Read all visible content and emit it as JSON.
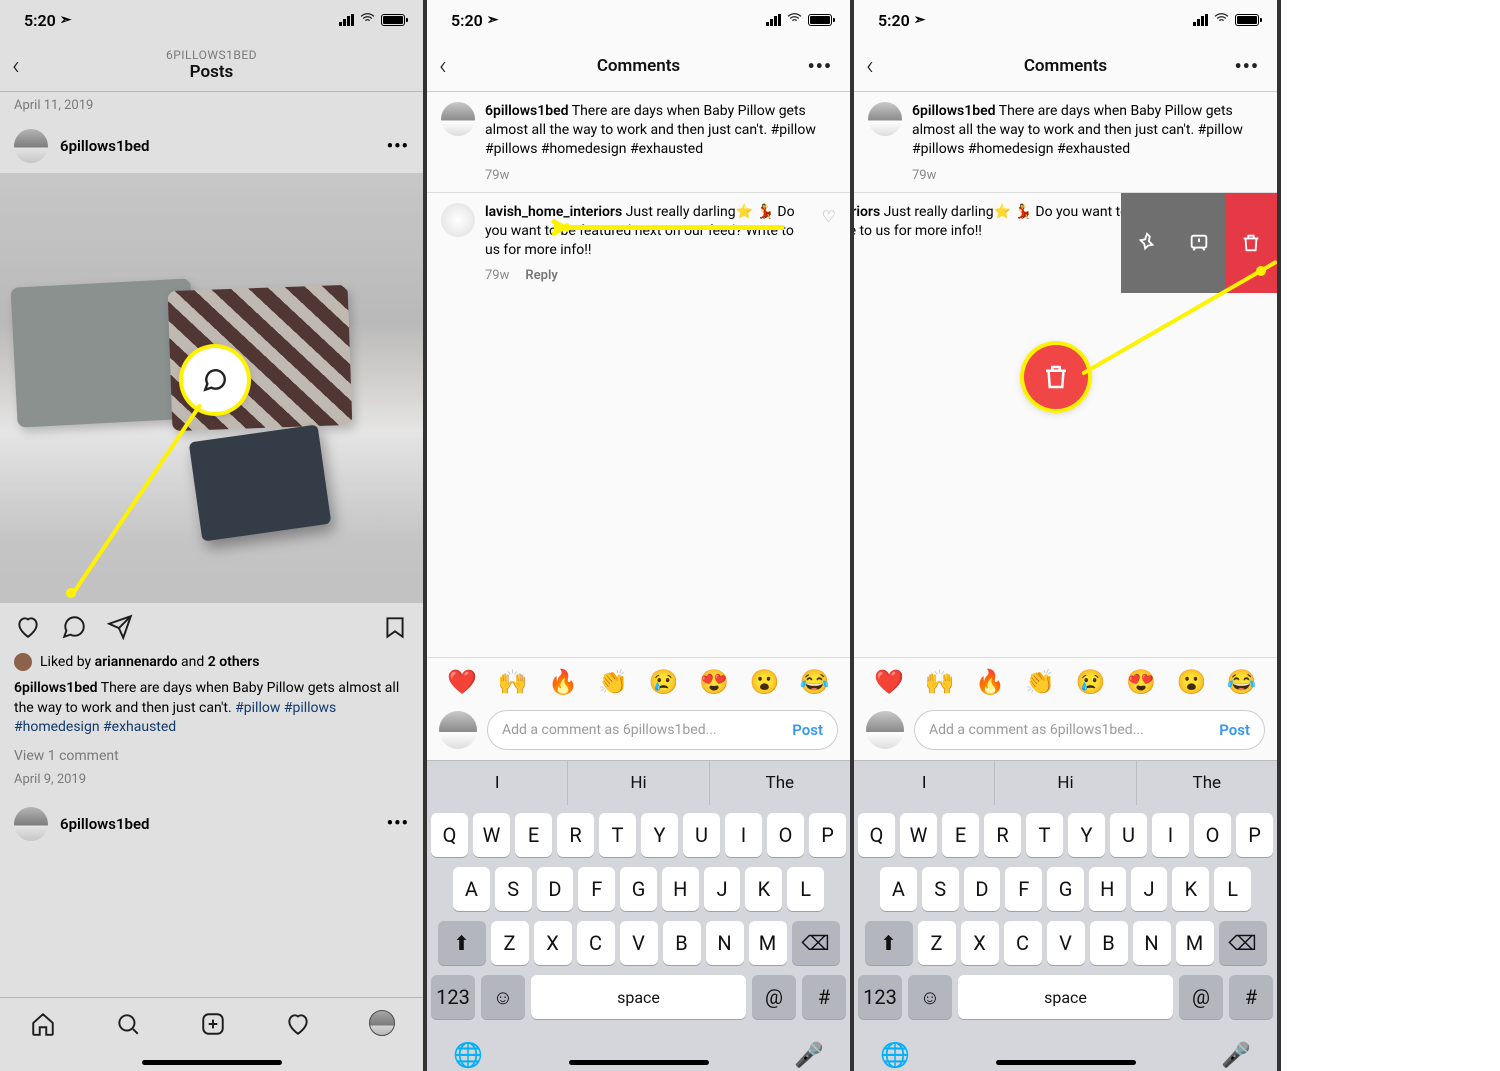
{
  "status": {
    "time": "5:20",
    "nav_glyph": "➤"
  },
  "screen1": {
    "username_upper": "6PILLOWS1BED",
    "title": "Posts",
    "date_top": "April 11, 2019",
    "post_username": "6pillows1bed",
    "liked_by_prefix": "Liked by ",
    "liked_by_name": "ariannenardo",
    "liked_by_middle": " and ",
    "liked_by_others": "2 others",
    "caption_user": "6pillows1bed",
    "caption_text": " There are days when Baby Pillow gets almost all the way to work and then just can't. ",
    "hashtags": [
      "#pillow",
      "#pillows",
      "#homedesign",
      "#exhausted"
    ],
    "view_comments": "View 1 comment",
    "post_date": "April 9, 2019",
    "next_username": "6pillows1bed"
  },
  "comments_header": {
    "title": "Comments"
  },
  "caption_comment": {
    "user": "6pillows1bed",
    "text": " There are days when Baby Pillow gets almost all the way to work and then just can't. ",
    "hashtags": [
      "#pillow",
      "#pillows",
      "#homedesign",
      "#exhausted"
    ],
    "age": "79w"
  },
  "reply_comment": {
    "user": "lavish_home_interiors",
    "text": " Just really darling⭐️ 💃 Do you want to be featured next on our feed? Write to us for more info!!",
    "age": "79w",
    "reply_label": "Reply"
  },
  "reply_swiped": {
    "visible_user_fragment": "nteriors",
    "visible_text": " Just really darling⭐️\nt to be featured next on our\nus for more info!!"
  },
  "emoji_row": [
    "❤️",
    "🙌",
    "🔥",
    "👏",
    "😢",
    "😍",
    "😮",
    "😂"
  ],
  "comment_input": {
    "placeholder": "Add a comment as 6pillows1bed...",
    "post": "Post"
  },
  "suggestions": [
    "I",
    "Hi",
    "The"
  ],
  "keyboard": {
    "row1": [
      "Q",
      "W",
      "E",
      "R",
      "T",
      "Y",
      "U",
      "I",
      "O",
      "P"
    ],
    "row2": [
      "A",
      "S",
      "D",
      "F",
      "G",
      "H",
      "J",
      "K",
      "L"
    ],
    "row3": [
      "Z",
      "X",
      "C",
      "V",
      "B",
      "N",
      "M"
    ],
    "num": "123",
    "space": "space",
    "at": "@",
    "hash": "#"
  }
}
